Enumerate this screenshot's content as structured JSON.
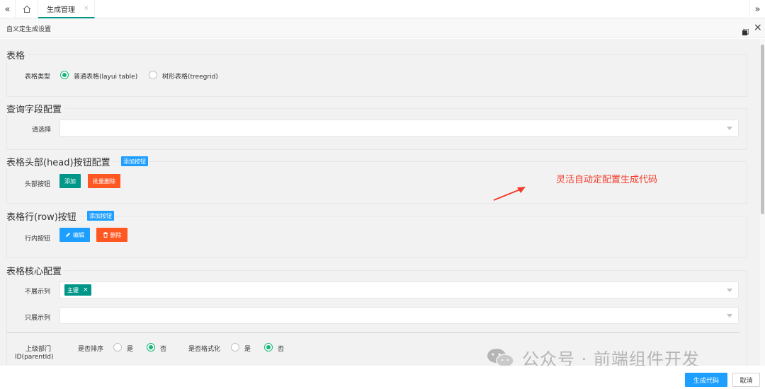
{
  "tabbar": {
    "left_arrow": "«",
    "home_icon": "home-icon",
    "active_tab": "生成管理",
    "close": "×",
    "right_arrow": "»"
  },
  "dialog": {
    "title": "自义定生成设置",
    "max_icon": "▀",
    "close": "×"
  },
  "sections": {
    "table": {
      "legend": "表格",
      "type_label": "表格类型",
      "option1": "普通表格(layui table)",
      "option2": "树形表格(treegrid)"
    },
    "query": {
      "legend": "查询字段配置",
      "select_label": "请选择"
    },
    "head": {
      "legend": "表格头部(head)按钮配置",
      "add_button": "添加按钮",
      "row_label": "头部按钮",
      "btn_add": "添加",
      "btn_batch_delete": "批量删除"
    },
    "row": {
      "legend": "表格行(row)按钮",
      "add_button": "添加按钮",
      "row_label": "行内按钮",
      "btn_edit": "编辑",
      "btn_delete": "删除"
    },
    "core": {
      "legend": "表格核心配置",
      "hide_label": "不展示列",
      "hide_tag": "主键",
      "tag_close": "×",
      "show_label": "只展示列",
      "parent_label_line1": "上级部门",
      "parent_label_line2": "ID(parentId)",
      "sort_label": "是否排序",
      "sort_yes": "是",
      "sort_no": "否",
      "format_label": "是否格式化",
      "format_yes": "是",
      "format_no": "否"
    }
  },
  "annotation": "灵活自动定配置生成代码",
  "watermark": "公众号 · 前端组件开发",
  "footer": {
    "generate": "生成代码",
    "cancel": "取消"
  },
  "colors": {
    "green": "#009688",
    "orange": "#ff5722",
    "blue": "#1e9fff",
    "radio": "#16b777",
    "annotation": "#f33b2b"
  }
}
